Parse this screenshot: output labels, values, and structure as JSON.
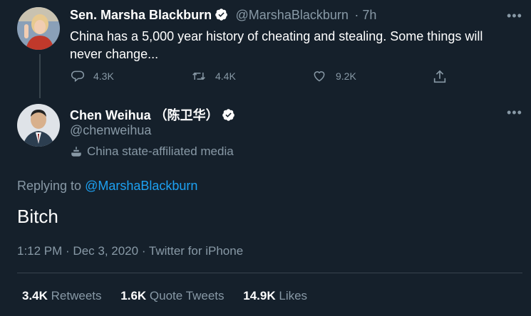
{
  "tweet1": {
    "name": "Sen. Marsha Blackburn",
    "handle": "@MarshaBlackburn",
    "time": "· 7h",
    "text_line1": "China has a 5,000 year history of cheating and stealing. Some things will",
    "text_line2": "never change...",
    "replies": "4.3K",
    "retweets": "4.4K",
    "likes": "9.2K",
    "more": "•••"
  },
  "tweet2": {
    "name": "Chen Weihua （陈卫华）",
    "handle": "@chenweihua",
    "label": "China state-affiliated media",
    "replying_prefix": "Replying to",
    "replying_to": "@MarshaBlackburn",
    "text": "Bitch",
    "meta": "1:12 PM · Dec 3, 2020 · Twitter for iPhone",
    "more": "•••"
  },
  "stats": {
    "retweets_count": "3.4K",
    "retweets_label": "Retweets",
    "quotes_count": "1.6K",
    "quotes_label": "Quote Tweets",
    "likes_count": "14.9K",
    "likes_label": "Likes"
  },
  "colors": {
    "background": "#15202b",
    "muted": "#8899a6",
    "accent": "#1da1f2",
    "divider": "#38444d"
  },
  "icons": [
    "reply-icon",
    "retweet-icon",
    "like-icon",
    "share-icon",
    "verified-icon",
    "state-media-icon",
    "more-icon"
  ]
}
